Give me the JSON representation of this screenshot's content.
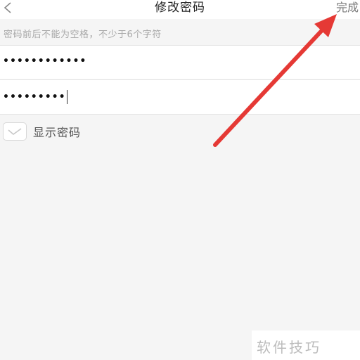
{
  "header": {
    "title": "修改密码",
    "done_label": "完成"
  },
  "hint": "密码前后不能为空格，不少于6个字符",
  "fields": [
    {
      "value": "••••••••••••"
    },
    {
      "value": "•••••••••"
    }
  ],
  "show_password": {
    "label": "显示密码",
    "checked": false
  },
  "watermark": "软件技巧",
  "colors": {
    "background": "#f5f5f5",
    "arrow": "#e53935",
    "hint_text": "#a8a8a8"
  }
}
